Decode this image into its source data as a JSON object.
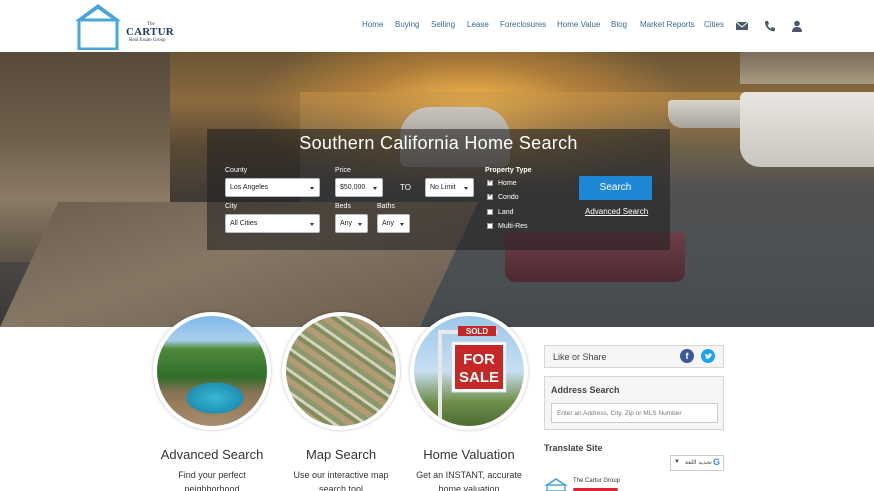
{
  "brand": {
    "the": "The",
    "name": "CARTUR",
    "sub": "Real Estate Group"
  },
  "nav": {
    "items": [
      "Home",
      "Buying",
      "Selling",
      "Lease",
      "Foreclosures",
      "Home Value",
      "Blog",
      "Market Reports",
      "Cities"
    ],
    "icons": [
      "envelope-icon",
      "phone-icon",
      "user-icon"
    ]
  },
  "search": {
    "title": "Southern California Home Search",
    "county_label": "County",
    "county_value": "Los Angeles",
    "city_label": "City",
    "city_value": "All Cities",
    "price_label": "Price",
    "price_min": "$50,000",
    "to_label": "TO",
    "price_max": "No Limit",
    "beds_label": "Beds",
    "beds_value": "Any",
    "baths_label": "Baths",
    "baths_value": "Any",
    "property_type_label": "Property Type",
    "property_types": [
      {
        "label": "Home",
        "checked": true
      },
      {
        "label": "Condo",
        "checked": true
      },
      {
        "label": "Land",
        "checked": false
      },
      {
        "label": "Multi-Res",
        "checked": false
      }
    ],
    "search_button": "Search",
    "advanced_link": "Advanced Search"
  },
  "features": [
    {
      "title": "Advanced Search",
      "desc": "Find your perfect neighborhood"
    },
    {
      "title": "Map Search",
      "desc": "Use our interactive map search tool"
    },
    {
      "title": "Home Valuation",
      "desc": "Get an INSTANT, accurate home valuation"
    }
  ],
  "sidebar": {
    "share_label": "Like or Share",
    "facebook_glyph": "f",
    "address_title": "Address Search",
    "address_placeholder": "Enter an Address, City, Zip or MLS Number",
    "translate_title": "Translate Site",
    "translate_widget_text": "تحديد اللغة",
    "translate_arrow": "▼",
    "google_glyph": "G",
    "company_name": "The Cartur Group"
  },
  "colors": {
    "accent": "#1e88d6",
    "nav_link": "#3a6a92",
    "logo_blue": "#1e3a5f",
    "facebook": "#3b5998",
    "twitter": "#1da1f2"
  }
}
